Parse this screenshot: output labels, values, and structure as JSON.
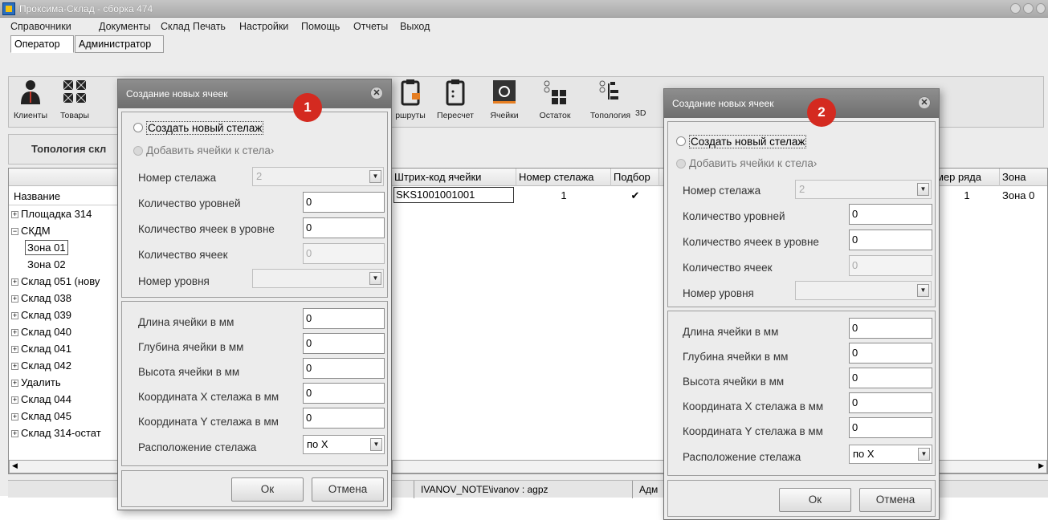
{
  "app": {
    "title": "Проксима-Склад - сборка 474"
  },
  "menu": [
    "Справочники",
    "Документы",
    "Склад",
    "Печать",
    "Настройки",
    "Помощь",
    "Отчеты",
    "Выход"
  ],
  "role_tabs": [
    "Оператор",
    "Администратор"
  ],
  "toolbar": {
    "items": [
      "Клиенты",
      "Товары",
      "ршруты",
      "Пересчет",
      "Ячейки",
      "Остаток",
      "Топология",
      "3D"
    ]
  },
  "left_panel": {
    "title": "Топология скл",
    "tree_header": "Название",
    "tree": [
      {
        "label": "Площадка 314",
        "expander": "+"
      },
      {
        "label": "СКДМ",
        "expander": "−"
      },
      {
        "label": "Зона 01",
        "child": true,
        "selected": true
      },
      {
        "label": "Зона 02",
        "child": true
      },
      {
        "label": "Склад 051 (нову",
        "expander": "+"
      },
      {
        "label": "Склад 038",
        "expander": "+"
      },
      {
        "label": "Склад 039",
        "expander": "+"
      },
      {
        "label": "Склад 040",
        "expander": "+"
      },
      {
        "label": "Склад 041",
        "expander": "+"
      },
      {
        "label": "Склад 042",
        "expander": "+"
      },
      {
        "label": "Удалить",
        "expander": "+"
      },
      {
        "label": "Склад 044",
        "expander": "+"
      },
      {
        "label": "Склад 045",
        "expander": "+"
      },
      {
        "label": "Склад 314-остат",
        "expander": "+"
      }
    ]
  },
  "grid": {
    "headers": [
      "Штрих-код ячейки",
      "Номер стелажа",
      "Подбор",
      "мер ряда",
      "Зона"
    ],
    "row": {
      "barcode": "SKS1001001001",
      "rack": "1",
      "pick": "✔",
      "row_no": "1",
      "zone": "Зона 0"
    }
  },
  "status_bar": {
    "user": "IVANOV_NOTE\\ivanov : agpz",
    "role": "Адм"
  },
  "dialog_common": {
    "title": "Создание новых ячеек",
    "radio_new": "Создать новый стелаж",
    "radio_add": "Добавить ячейки к стела›",
    "labels": {
      "rack_no": "Номер стелажа",
      "levels": "Количество уровней",
      "cells_per_level": "Количество ячеек в уровне",
      "cells": "Количество ячеек",
      "level_no": "Номер уровня",
      "length": "Длина ячейки в мм",
      "depth": "Глубина ячейки в мм",
      "height": "Высота ячейки в мм",
      "coord_x": "Координата X стелажа в мм",
      "coord_y": "Координата Y стелажа в мм",
      "placement": "Расположение стелажа"
    },
    "values": {
      "rack_no": "2",
      "levels": "0",
      "cells_per_level": "0",
      "cells": "0",
      "level_no": "",
      "length": "0",
      "depth": "0",
      "height": "0",
      "coord_x": "0",
      "coord_y": "0",
      "placement": "по X"
    },
    "ok": "Ок",
    "cancel": "Отмена"
  },
  "badges": [
    "1",
    "2"
  ],
  "colors": {
    "badge": "#d42a20",
    "dialog_title": "#7a7a7a"
  }
}
